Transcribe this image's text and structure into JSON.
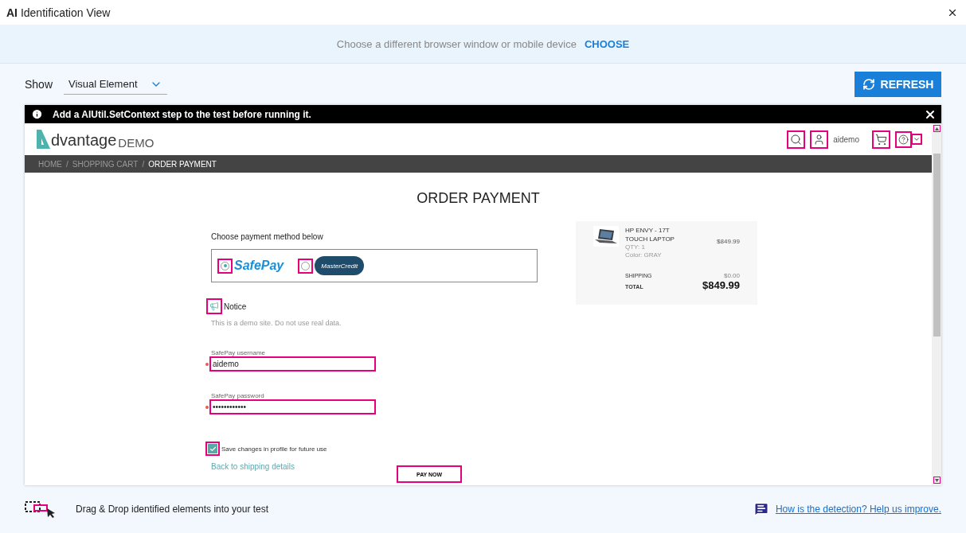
{
  "window": {
    "title": "**AI** Identification View"
  },
  "banner": {
    "text": "Choose a different browser window or mobile device",
    "link": "CHOOSE"
  },
  "show": {
    "label": "Show",
    "value": "Visual Element"
  },
  "refresh_button": {
    "label": "REFRESH"
  },
  "notice_bar": {
    "text": "Add a AIUtil.SetContext step to the test before running it."
  },
  "site": {
    "logo": {
      "word": "dvantage",
      "suffix": "DEMO"
    },
    "username": "aidemo",
    "header_icons": [
      {
        "kind": "search",
        "highlighted": true
      },
      {
        "kind": "user",
        "highlighted": true
      },
      {
        "kind": "cart",
        "highlighted": true
      },
      {
        "kind": "help",
        "highlighted": true
      },
      {
        "kind": "chevron",
        "highlighted": true
      }
    ],
    "breadcrumb": {
      "separator": "/",
      "items": [
        {
          "label": "HOME",
          "selected": false
        },
        {
          "label": "SHOPPING CART",
          "selected": false
        },
        {
          "label": "ORDER PAYMENT",
          "selected": true
        }
      ]
    },
    "page_title": "ORDER PAYMENT",
    "payment": {
      "heading": "Choose payment method below",
      "methods": [
        {
          "kind": "safepay",
          "label": "SafePay",
          "selected": true,
          "highlighted": true
        },
        {
          "kind": "mastercredit",
          "label": "MasterCredit",
          "selected": false,
          "highlighted": true
        }
      ]
    },
    "notice": {
      "title": "Notice",
      "text": "This is a demo site. Do not use real data.",
      "highlighted": true
    },
    "fields": [
      {
        "label": "SafePay username",
        "value": "aidemo",
        "required": true,
        "highlighted": true
      },
      {
        "label": "SafePay password",
        "value": "••••••••••••",
        "required": true,
        "highlighted": true
      }
    ],
    "save_checkbox": {
      "label": "Save changes in profile for future use",
      "checked": true,
      "highlighted": true
    },
    "back_link": "Back to shipping details",
    "pay_button": {
      "label": "PAY NOW",
      "highlighted": true
    },
    "summary": {
      "product": "HP ENVY - 17T TOUCH LAPTOP",
      "price": "$849.99",
      "qty": "QTY: 1",
      "variant": "Color: GRAY",
      "shipping_label": "SHIPPING",
      "shipping": "$0.00",
      "total_label": "TOTAL",
      "total": "$849.99"
    }
  },
  "footer": {
    "hint": "Drag & Drop identified elements into your test",
    "feedback_link": "How is the detection? Help us improve."
  }
}
